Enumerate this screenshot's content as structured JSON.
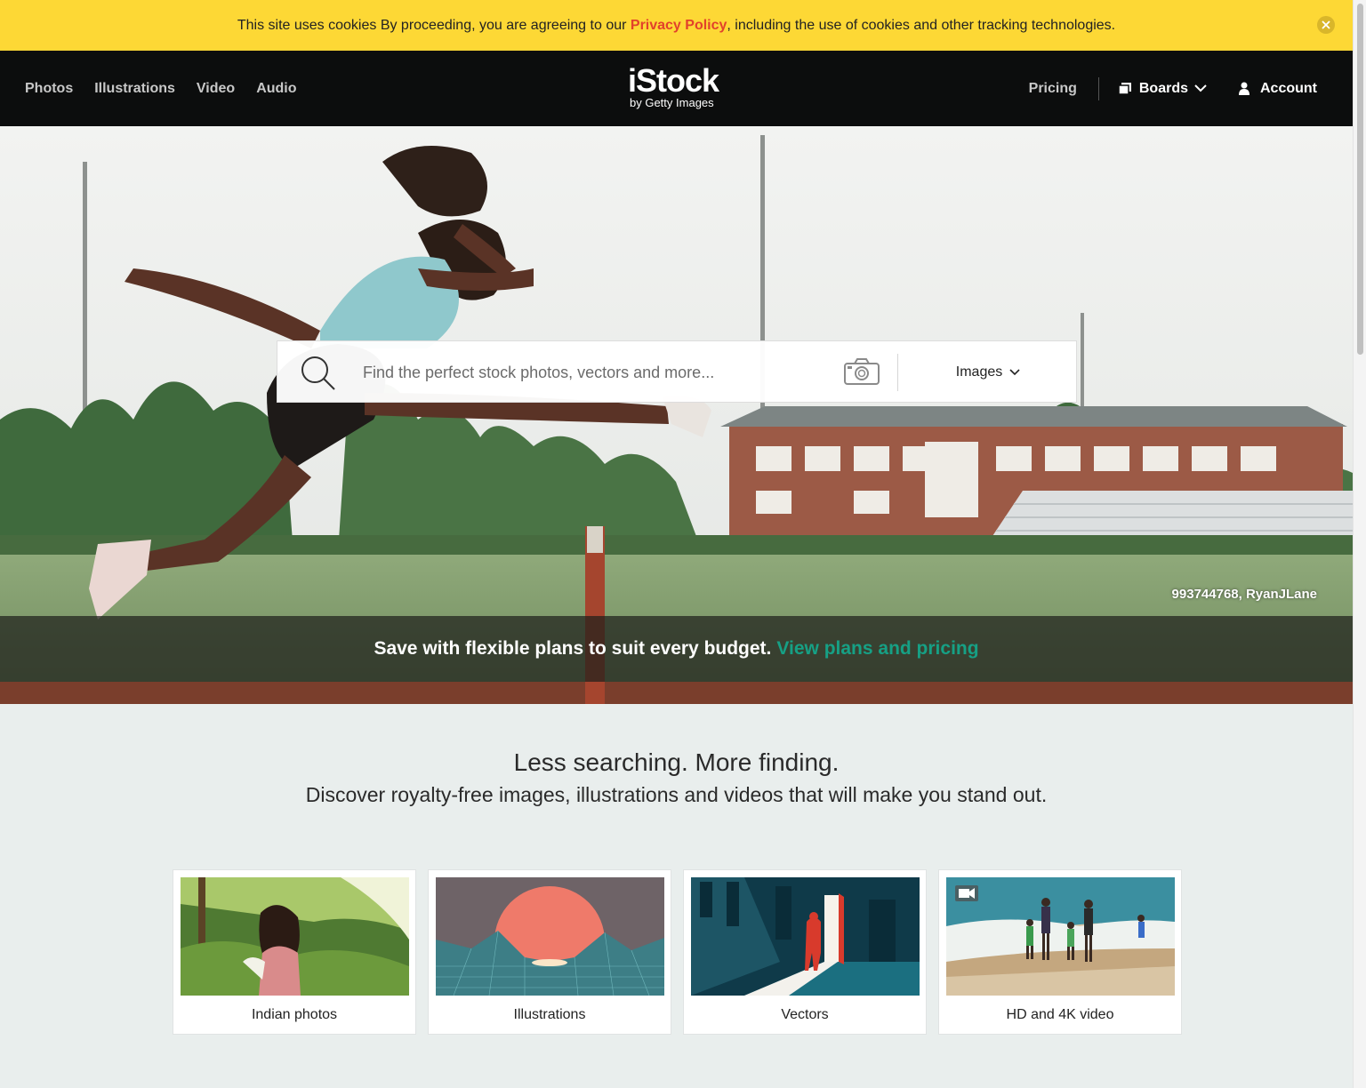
{
  "cookie_banner": {
    "text_before": "This site uses cookies By proceeding, you are agreeing to our ",
    "link": "Privacy Policy",
    "text_after": ", including the use of cookies and other tracking technologies.",
    "close_icon": "close-icon"
  },
  "header": {
    "nav_left": [
      "Photos",
      "Illustrations",
      "Video",
      "Audio"
    ],
    "logo_main": "iStock",
    "logo_sub": "by Getty Images",
    "pricing": "Pricing",
    "boards": "Boards",
    "account": "Account"
  },
  "search": {
    "placeholder": "Find the perfect stock photos, vectors and more...",
    "value": "",
    "type": "Images"
  },
  "hero": {
    "credit": "993744768, RyanJLane",
    "promo_text": "Save with flexible plans to suit every budget.",
    "promo_link": "View plans and pricing"
  },
  "main": {
    "title": "Less searching. More finding.",
    "subtitle": "Discover royalty-free images, illustrations and videos that will make you stand out.",
    "cards": [
      {
        "label": "Indian photos"
      },
      {
        "label": "Illustrations"
      },
      {
        "label": "Vectors"
      },
      {
        "label": "HD and 4K video"
      }
    ]
  },
  "colors": {
    "banner": "#fdd835",
    "privacy_link": "#e2412b",
    "header_bg": "#0c0d0d",
    "promo_link": "#16a085",
    "page_bg": "#e9eeed"
  }
}
